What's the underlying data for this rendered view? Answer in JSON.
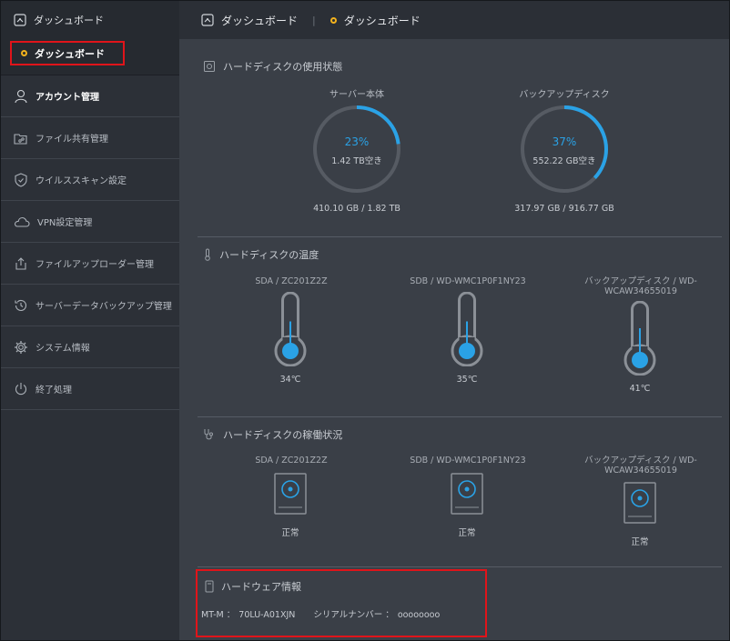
{
  "sidebar": {
    "dashboard": "ダッシュボード",
    "dashboard_sub": "ダッシュボード",
    "items": [
      {
        "label": "アカウント管理",
        "icon": "user-icon"
      },
      {
        "label": "ファイル共有管理",
        "icon": "folder-share-icon"
      },
      {
        "label": "ウイルススキャン設定",
        "icon": "shield-icon"
      },
      {
        "label": "VPN設定管理",
        "icon": "cloud-icon"
      },
      {
        "label": "ファイルアップローダー管理",
        "icon": "upload-icon"
      },
      {
        "label": "サーバーデータバックアップ管理",
        "icon": "history-icon"
      },
      {
        "label": "システム情報",
        "icon": "gear-icon"
      },
      {
        "label": "終了処理",
        "icon": "power-icon"
      }
    ]
  },
  "header": {
    "title": "ダッシュボード",
    "breadcrumb": "ダッシュボード",
    "separator": "|"
  },
  "usage": {
    "title": "ハードディスクの使用状態",
    "server": {
      "label": "サーバー本体",
      "percent": 23,
      "pct_text": "23%",
      "free": "1.42 TB空き",
      "capacity": "410.10 GB / 1.82 TB"
    },
    "backup": {
      "label": "バックアップディスク",
      "percent": 37,
      "pct_text": "37%",
      "free": "552.22 GB空き",
      "capacity": "317.97 GB / 916.77 GB"
    }
  },
  "temperature": {
    "title": "ハードディスクの温度",
    "disks": [
      {
        "label": "SDA / ZC201Z2Z",
        "value": "34℃",
        "level": 0.55
      },
      {
        "label": "SDB / WD-WMC1P0F1NY23",
        "value": "35℃",
        "level": 0.55
      },
      {
        "label": "バックアップディスク / WD-WCAW34655019",
        "value": "41℃",
        "level": 0.6
      }
    ]
  },
  "status": {
    "title": "ハードディスクの稼働状況",
    "disks": [
      {
        "label": "SDA / ZC201Z2Z",
        "value": "正常"
      },
      {
        "label": "SDB / WD-WMC1P0F1NY23",
        "value": "正常"
      },
      {
        "label": "バックアップディスク / WD-WCAW34655019",
        "value": "正常"
      }
    ]
  },
  "hardware": {
    "title": "ハードウェア情報",
    "model_label": "MT-M ：",
    "model_value": "70LU-A01XJN",
    "serial_label": "シリアルナンバー ：",
    "serial_value": "oooooooo"
  },
  "colors": {
    "accent": "#2aa2e6",
    "highlight": "#e0141a",
    "dot": "#f3b21d"
  }
}
